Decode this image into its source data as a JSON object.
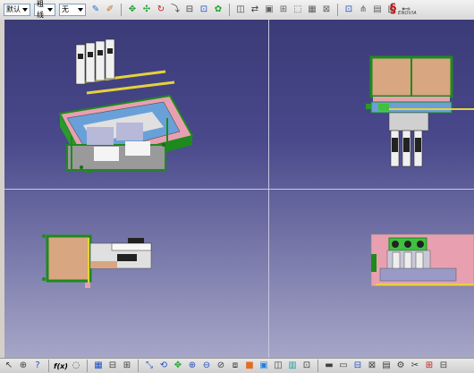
{
  "toolbar_top": {
    "style_select": "默认",
    "weight_select": "粗线",
    "layer_select": "无",
    "icons": [
      "pen-icon",
      "brush-icon",
      "pan-icon",
      "rotate-icon",
      "zoom-in-icon",
      "zoom-out-icon",
      "normal-view-icon",
      "multi-view-icon",
      "render-icon",
      "hide-show-icon",
      "swap-icon",
      "measure-icon",
      "analysis-icon",
      "capture-icon",
      "settings-icon",
      "grid-icon"
    ]
  },
  "logo": {
    "mark": "§",
    "word": "ENOVIA"
  },
  "toolbar_bottom": {
    "formula_label": "f(x)",
    "icons": [
      "select-icon",
      "zoom-icon",
      "help-icon",
      "formula-icon",
      "comment-icon",
      "table-icon",
      "fly-icon",
      "fit-all-icon",
      "pan-icon",
      "rotate-icon",
      "zoom-in-icon",
      "zoom-out-icon",
      "normal-icon",
      "iso-view-icon",
      "shading-icon",
      "hide-icon",
      "swap-view-icon",
      "measure-icon",
      "snapshot-icon",
      "sectioning-icon",
      "material-icon",
      "apply-icon",
      "analysis-icon",
      "print-icon"
    ]
  },
  "colors": {
    "bg_top": "#3b3b78",
    "bg_bottom": "#a6a6c8",
    "frame_green": "#1e8a1e",
    "panel_tan": "#d8a680",
    "rail_yellow": "#e6d23a",
    "panel_pink": "#e8a0b0",
    "panel_blue": "#6aa0d8"
  }
}
